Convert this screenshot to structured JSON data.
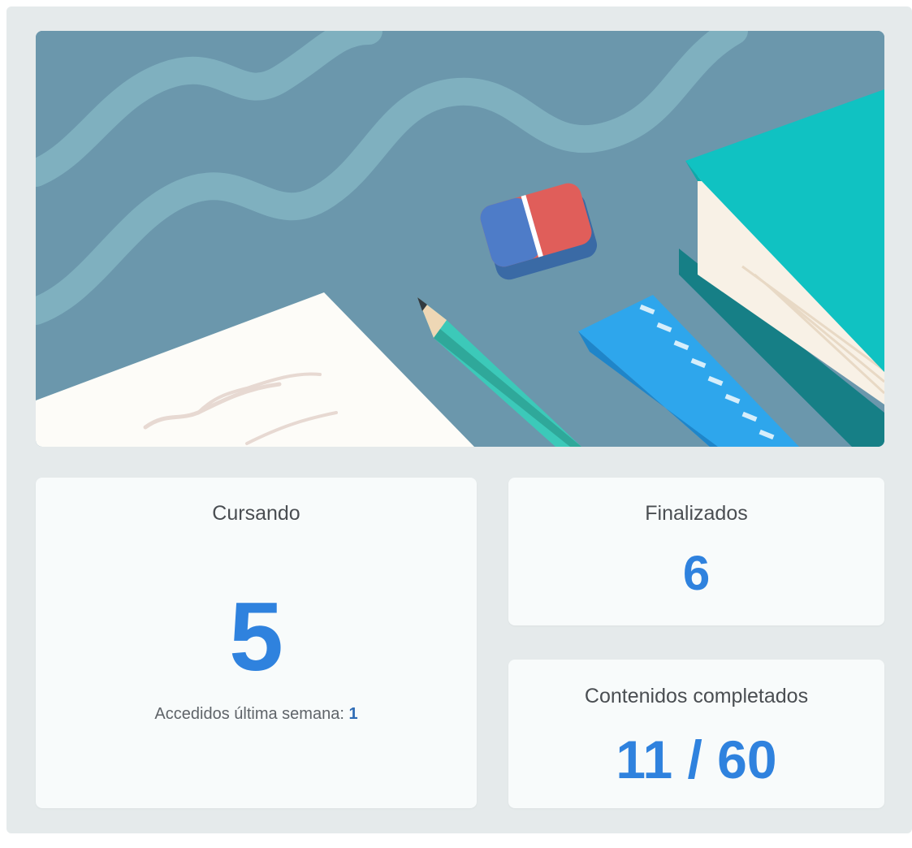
{
  "banner": {
    "icon": "school-supplies-illustration",
    "colors": {
      "background": "#6b97ac",
      "wave": "#7fb0bf",
      "book_cover": "#10c2c2",
      "ruler": "#2ea6ec",
      "eraser_red": "#e05e5a",
      "eraser_blue": "#4e7cc8",
      "pencil": "#3cc9b9",
      "paper": "#fdfcf8"
    }
  },
  "stats": {
    "cursando": {
      "title": "Cursando",
      "value": "5",
      "sub_label": "Accedidos última semana: ",
      "sub_value": "1"
    },
    "finalizados": {
      "title": "Finalizados",
      "value": "6"
    },
    "contenidos": {
      "title": "Contenidos completados",
      "value": "11 / 60"
    }
  },
  "colors": {
    "accent": "#2f82de",
    "panel_background": "#e5eaeb",
    "card_background": "#f8fbfb",
    "title_text": "#4a4e52"
  }
}
